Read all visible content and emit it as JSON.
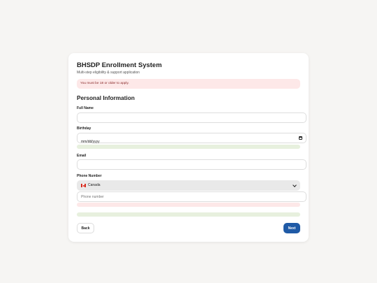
{
  "header": {
    "title": "BHSDP Enrollment System",
    "subtitle": "Multi-step eligibility & support application"
  },
  "alert": {
    "message": "You must be 18 or older to apply."
  },
  "section": {
    "title": "Personal Information"
  },
  "fields": {
    "full_name": {
      "label": "Full Name",
      "value": ""
    },
    "birthday": {
      "label": "Birthday",
      "placeholder": "mm/dd/yyyy",
      "icon": "calendar-icon"
    },
    "email": {
      "label": "Email",
      "value": ""
    },
    "phone": {
      "label": "Phone Number",
      "country": "Canada",
      "country_flag": "canada-flag-icon",
      "placeholder": "Phone number"
    }
  },
  "buttons": {
    "back": "Back",
    "next": "Next"
  },
  "colors": {
    "page_background": "#f6f5f3",
    "card_background": "#ffffff",
    "error_background": "#fde8e8",
    "error_text": "#8a2a2a",
    "valid_background": "#e7f0de",
    "select_background": "#e9e9e9",
    "primary_button": "#1f5aa6"
  }
}
